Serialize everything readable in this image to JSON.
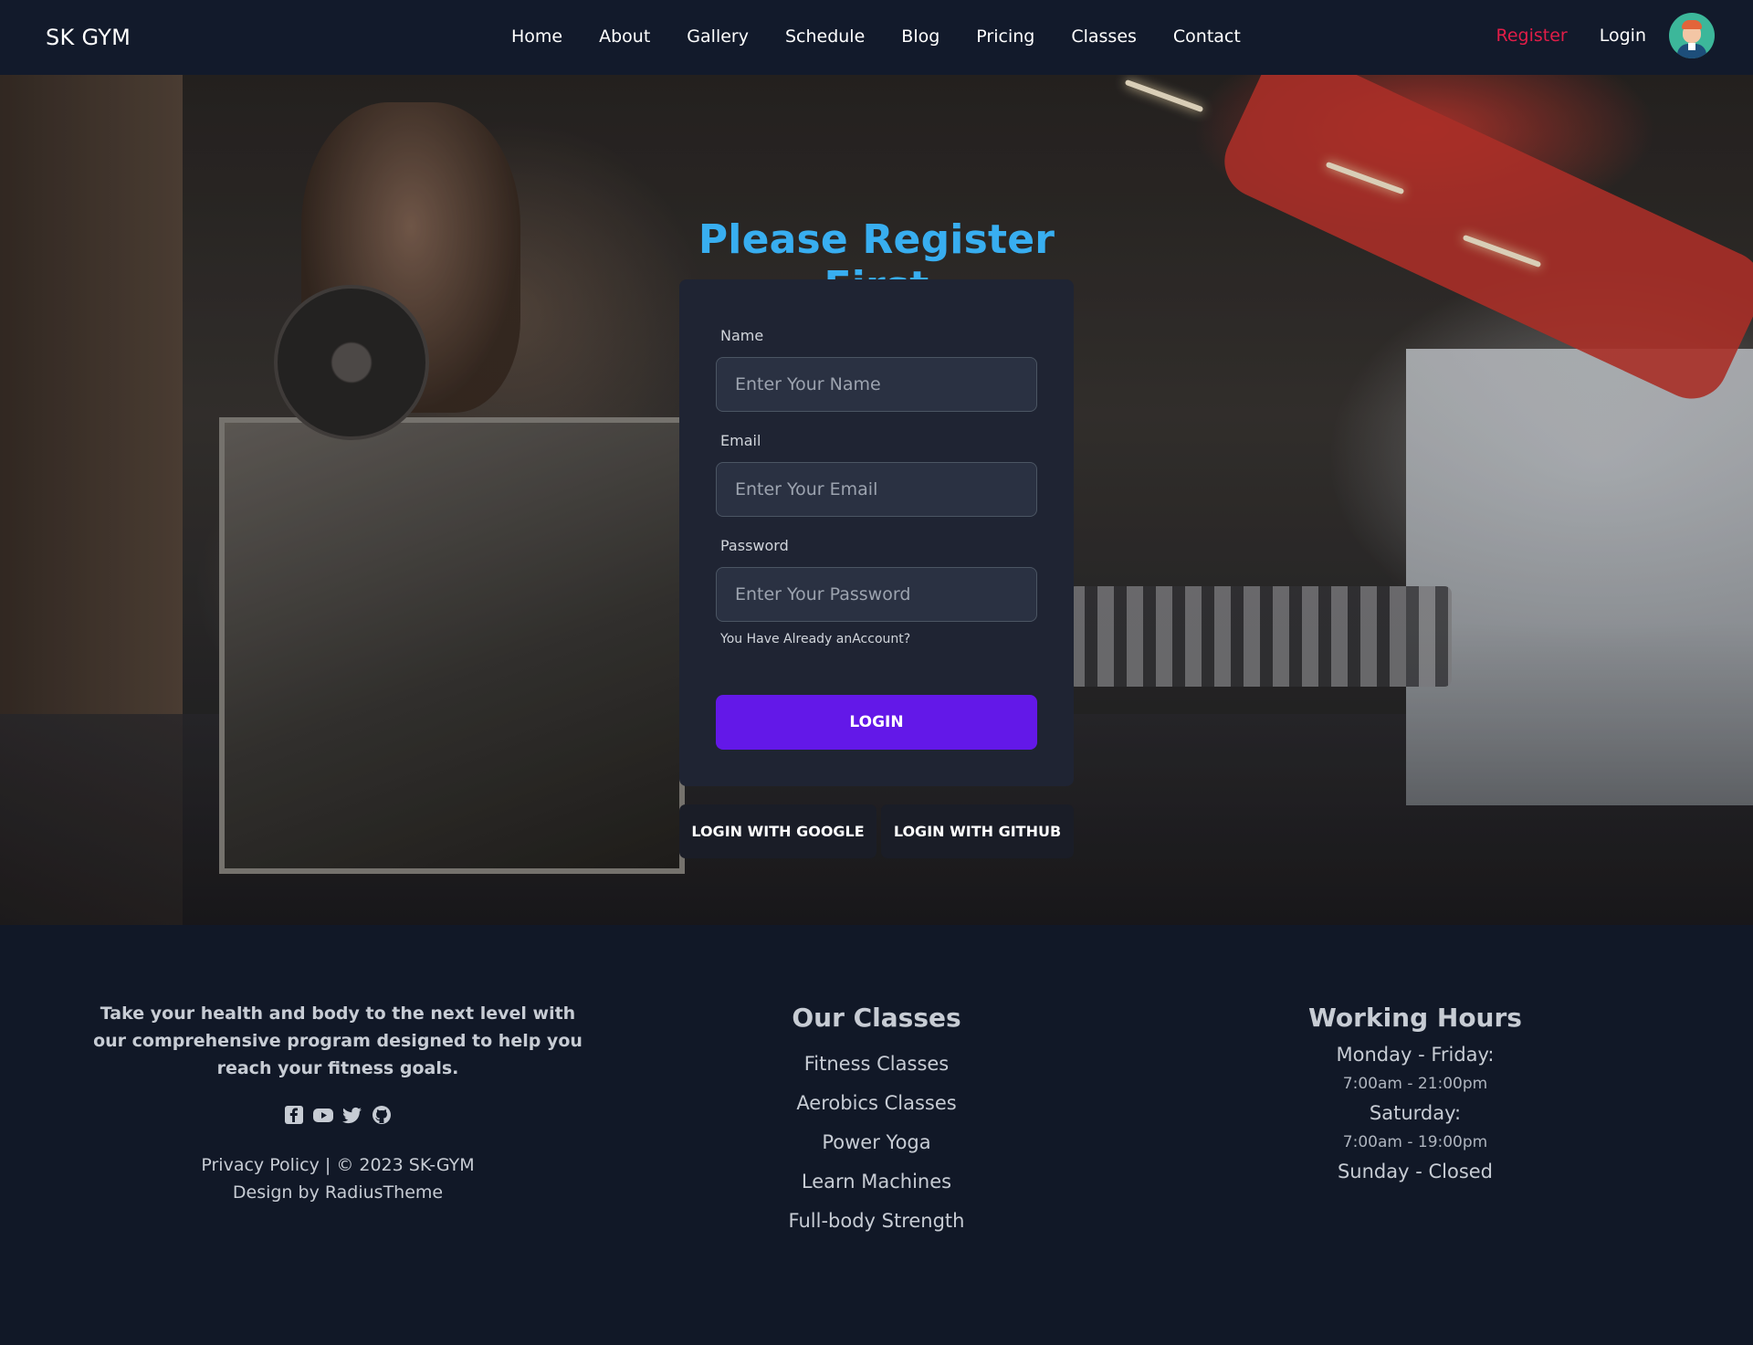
{
  "navbar": {
    "brand": "SK GYM",
    "links": [
      "Home",
      "About",
      "Gallery",
      "Schedule",
      "Blog",
      "Pricing",
      "Classes",
      "Contact"
    ],
    "register": "Register",
    "login": "Login",
    "avatar_icon": "user-avatar-icon"
  },
  "form": {
    "title": "Please Register First",
    "name_label": "Name",
    "name_placeholder": "Enter Your Name",
    "email_label": "Email",
    "email_placeholder": "Enter Your Email",
    "password_label": "Password",
    "password_placeholder": "Enter Your Password",
    "account_link": "You Have Already anAccount?",
    "login_button": "LOGIN",
    "google_button": "LOGIN WITH GOOGLE",
    "github_button": "LOGIN WITH GITHUB"
  },
  "footer": {
    "about": "Take your health and body to the next level with our comprehensive program designed to help you reach your fitness goals.",
    "social_icons": [
      "facebook-icon",
      "youtube-icon",
      "twitter-icon",
      "github-icon"
    ],
    "legal_line1": "Privacy Policy | © 2023 SK-GYM",
    "legal_line2": "Design by RadiusTheme",
    "classes_title": "Our Classes",
    "classes": [
      "Fitness Classes",
      "Aerobics Classes",
      "Power Yoga",
      "Learn Machines",
      "Full-body Strength"
    ],
    "hours_title": "Working Hours",
    "hours": [
      {
        "day": "Monday - Friday:",
        "time": "7:00am - 21:00pm"
      },
      {
        "day": "Saturday:",
        "time": "7:00am - 19:00pm"
      },
      {
        "day": "Sunday - Closed",
        "time": ""
      }
    ]
  },
  "colors": {
    "accent": "#6318e8",
    "title_blue": "#38aef0",
    "register_red": "#e11d48",
    "navbar_bg": "#121a2b",
    "footer_bg": "#111827"
  }
}
